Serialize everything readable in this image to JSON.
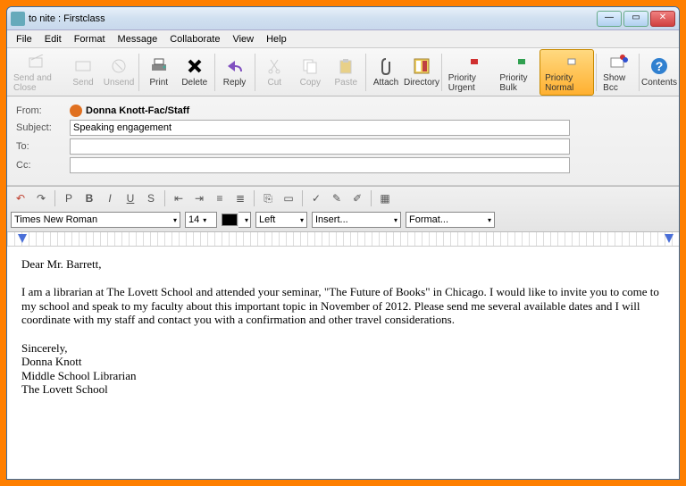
{
  "window": {
    "title": "to nite : Firstclass"
  },
  "menu": [
    "File",
    "Edit",
    "Format",
    "Message",
    "Collaborate",
    "View",
    "Help"
  ],
  "toolbar": {
    "sendclose": "Send and Close",
    "send": "Send",
    "unsend": "Unsend",
    "print": "Print",
    "delete": "Delete",
    "reply": "Reply",
    "cut": "Cut",
    "copy": "Copy",
    "paste": "Paste",
    "attach": "Attach",
    "directory": "Directory",
    "purgent": "Priority Urgent",
    "pbulk": "Priority Bulk",
    "pnormal": "Priority Normal",
    "showbcc": "Show Bcc",
    "contents": "Contents"
  },
  "header": {
    "from_lbl": "From:",
    "from_val": "Donna Knott-Fac/Staff",
    "subject_lbl": "Subject:",
    "subject_val": "Speaking engagement",
    "to_lbl": "To:",
    "to_val": "",
    "cc_lbl": "Cc:",
    "cc_val": ""
  },
  "format": {
    "font": "Times New Roman",
    "size": "14",
    "align": "Left",
    "insert": "Insert...",
    "fmt": "Format..."
  },
  "body": {
    "greeting": "Dear Mr. Barrett,",
    "para": "I am a librarian at The Lovett School and attended your seminar, \"The Future of Books\" in Chicago.  I would like to invite you to come to my school and speak to my faculty about this important topic in November of 2012.  Please send me several available dates and I will coordinate with my staff and contact you with a confirmation and other travel considerations.",
    "signoff": "Sincerely,",
    "name": "Donna Knott",
    "role": "Middle School Librarian",
    "org": "The Lovett School"
  }
}
